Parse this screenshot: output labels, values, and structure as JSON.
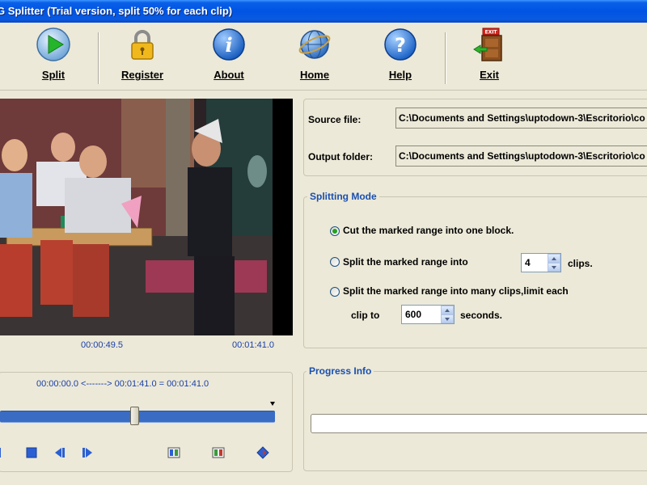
{
  "window": {
    "title": "G Splitter (Trial version, split 50% for each clip)"
  },
  "toolbar": {
    "split": "Split",
    "register": "Register",
    "about": "About",
    "home": "Home",
    "help": "Help",
    "exit": "Exit",
    "exit_sign": "EXIT"
  },
  "player": {
    "current_time": "00:00:49.5",
    "total_time": "00:01:41.0",
    "range": "00:00:00.0 <-------> 00:01:41.0 = 00:01:41.0",
    "position_fraction": 0.49
  },
  "files": {
    "source_label": "Source file:",
    "source_value": "C:\\Documents and Settings\\uptodown-3\\Escritorio\\co",
    "output_label": "Output folder:",
    "output_value": "C:\\Documents and Settings\\uptodown-3\\Escritorio\\co"
  },
  "splitting_mode": {
    "title": "Splitting Mode",
    "option1": "Cut the marked range into one block.",
    "option2": "Split the marked range into",
    "clips_value": "4",
    "clips_unit": "clips.",
    "option3": "Split the marked range into many clips,limit each",
    "clip_to_label": "clip to",
    "seconds_value": "600",
    "seconds_unit": "seconds.",
    "selected_option": 1
  },
  "progress": {
    "title": "Progress Info",
    "value": 0
  },
  "colors": {
    "titlebar": "#0054E3",
    "accent_text": "#1A4FB0",
    "timeline": "#3A6CC4"
  }
}
